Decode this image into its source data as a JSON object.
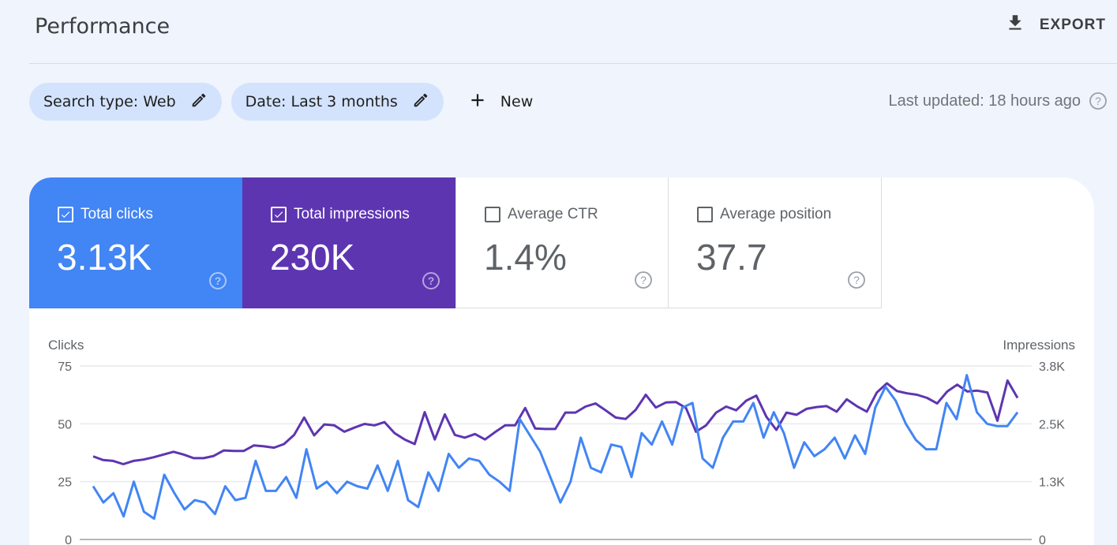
{
  "header": {
    "title": "Performance",
    "export_label": "EXPORT"
  },
  "filters": {
    "chips": [
      {
        "label": "Search type: Web"
      },
      {
        "label": "Date: Last 3 months"
      }
    ],
    "new_label": "New",
    "last_updated": "Last updated: 18 hours ago"
  },
  "metrics": [
    {
      "label": "Total clicks",
      "value": "3.13K",
      "checked": true,
      "color": "#4285f4"
    },
    {
      "label": "Total impressions",
      "value": "230K",
      "checked": true,
      "color": "#5e35b1"
    },
    {
      "label": "Average CTR",
      "value": "1.4%",
      "checked": false
    },
    {
      "label": "Average position",
      "value": "37.7",
      "checked": false
    }
  ],
  "chart_data": {
    "type": "line",
    "left_axis": {
      "title": "Clicks",
      "ticks": [
        "0",
        "25",
        "50",
        "75"
      ],
      "range": [
        0,
        75
      ]
    },
    "right_axis": {
      "title": "Impressions",
      "ticks": [
        "0",
        "1.3K",
        "2.5K",
        "3.8K"
      ],
      "range": [
        0,
        3800
      ]
    },
    "grid": true,
    "series": [
      {
        "name": "Clicks",
        "axis": "left",
        "color": "#4285f4",
        "values": [
          23,
          16,
          20,
          10,
          25,
          12,
          9,
          28,
          20,
          13,
          17,
          16,
          11,
          23,
          17,
          18,
          34,
          21,
          21,
          27,
          18,
          39,
          22,
          25,
          20,
          25,
          23,
          22,
          32,
          21,
          34,
          17,
          14,
          29,
          21,
          37,
          31,
          35,
          34,
          28,
          25,
          21,
          52,
          45,
          38,
          27,
          16,
          25,
          44,
          31,
          29,
          41,
          40,
          27,
          46,
          41,
          51,
          41,
          57,
          59,
          35,
          31,
          44,
          51,
          51,
          59,
          44,
          55,
          46,
          31,
          42,
          36,
          39,
          44,
          35,
          45,
          37,
          57,
          66,
          60,
          50,
          43,
          39,
          39,
          59,
          52,
          71,
          55,
          50,
          49,
          49,
          55
        ]
      },
      {
        "name": "Impressions",
        "axis": "right",
        "color": "#5e35b1",
        "values": [
          1820,
          1740,
          1720,
          1650,
          1720,
          1750,
          1800,
          1860,
          1920,
          1860,
          1780,
          1780,
          1830,
          1950,
          1940,
          1940,
          2060,
          2040,
          2010,
          2090,
          2290,
          2670,
          2280,
          2520,
          2500,
          2360,
          2450,
          2530,
          2500,
          2570,
          2330,
          2190,
          2090,
          2790,
          2190,
          2740,
          2290,
          2230,
          2310,
          2190,
          2350,
          2500,
          2500,
          2880,
          2430,
          2420,
          2420,
          2780,
          2780,
          2910,
          2980,
          2830,
          2670,
          2640,
          2840,
          3170,
          2890,
          3000,
          3010,
          2880,
          2360,
          2500,
          2780,
          2910,
          2830,
          3040,
          3150,
          2690,
          2400,
          2780,
          2730,
          2860,
          2900,
          2920,
          2800,
          3070,
          2920,
          2800,
          3220,
          3420,
          3250,
          3200,
          3170,
          3100,
          2980,
          3240,
          3390,
          3240,
          3260,
          3220,
          2600,
          3480,
          3100
        ]
      }
    ]
  }
}
